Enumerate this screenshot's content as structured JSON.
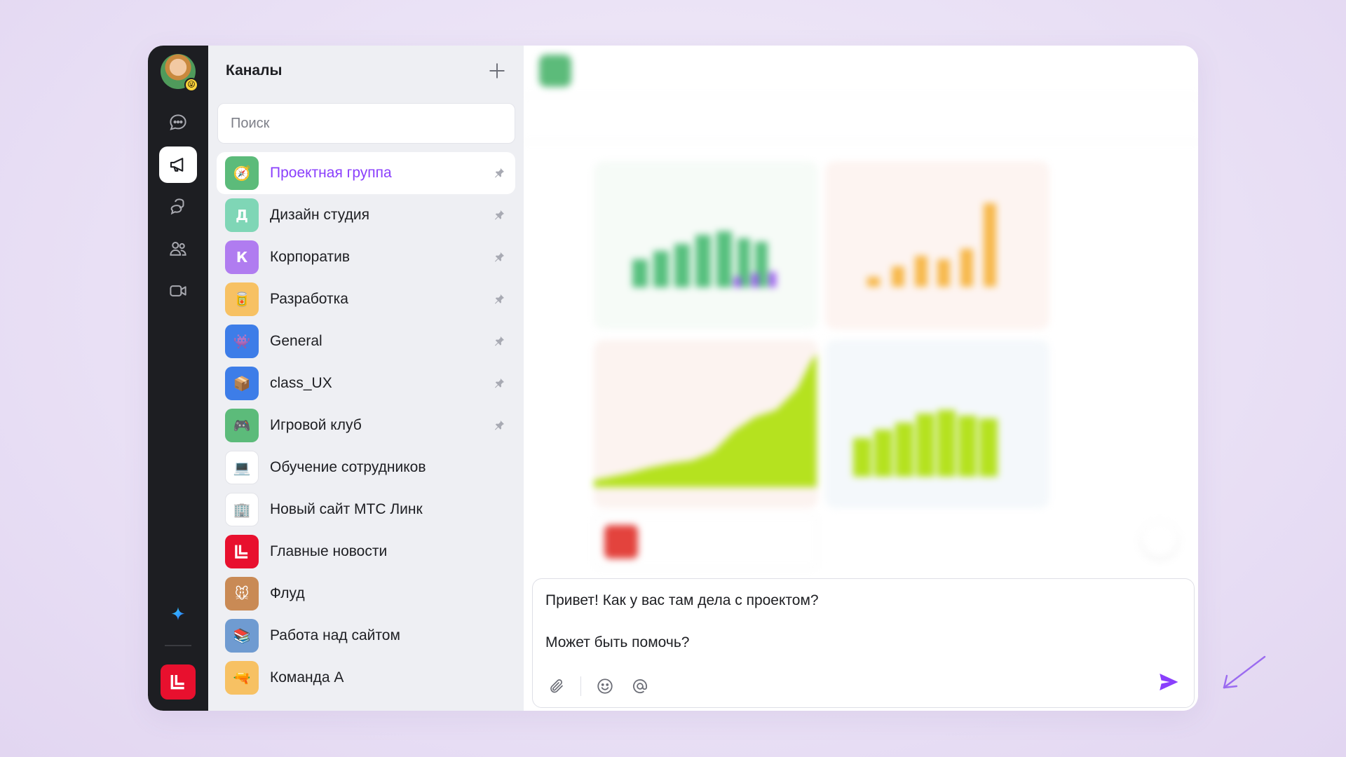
{
  "channels_panel": {
    "title": "Каналы",
    "search_placeholder": "Поиск",
    "items": [
      {
        "name": "Проектная группа",
        "icon": "compass-icon",
        "color": "#5cbb7a",
        "glyph": "🧭",
        "pinned": true,
        "active": true
      },
      {
        "name": "Дизайн студия",
        "icon": "letter-d-icon",
        "color": "#7fd6b6",
        "glyph": "Д",
        "pinned": true
      },
      {
        "name": "Корпоратив",
        "icon": "letter-k-icon",
        "color": "#b07cf0",
        "glyph": "К",
        "pinned": true
      },
      {
        "name": "Разработка",
        "icon": "jar-icon",
        "color": "#f7c163",
        "glyph": "🥫",
        "pinned": true
      },
      {
        "name": "General",
        "icon": "monster-icon",
        "color": "#3d7de8",
        "glyph": "👾",
        "pinned": true
      },
      {
        "name": "class_UX",
        "icon": "box-icon",
        "color": "#3d7de8",
        "glyph": "📦",
        "pinned": true
      },
      {
        "name": "Игровой клуб",
        "icon": "gamepad-icon",
        "color": "#5cbb7a",
        "glyph": "🎮",
        "pinned": true
      },
      {
        "name": "Обучение сотрудников",
        "icon": "laptop-mail-icon",
        "color": "#ffffff",
        "glyph": "💻",
        "pinned": false
      },
      {
        "name": "Новый сайт МТС Линк",
        "icon": "building-icon",
        "color": "#ffffff",
        "glyph": "🏢",
        "pinned": false
      },
      {
        "name": "Главные новости",
        "icon": "mts-link-logo-icon",
        "color": "#e8102e",
        "glyph": "",
        "pinned": false
      },
      {
        "name": "Флуд",
        "icon": "mouse-character-icon",
        "color": "#c98a55",
        "glyph": "🐭",
        "pinned": false
      },
      {
        "name": "Работа над сайтом",
        "icon": "books-icon",
        "color": "#6f9bd1",
        "glyph": "📚",
        "pinned": false
      },
      {
        "name": "Команда А",
        "icon": "water-gun-icon",
        "color": "#f7c163",
        "glyph": "🔫",
        "pinned": false
      }
    ]
  },
  "composer": {
    "line1": "Привет! Как у вас там дела с проектом?",
    "line2": "Может быть помочь?"
  },
  "colors": {
    "accent": "#8a3ffc",
    "rail_bg": "#1d1e22",
    "panel_bg": "#eeeff3",
    "brand_red": "#e8102e"
  }
}
